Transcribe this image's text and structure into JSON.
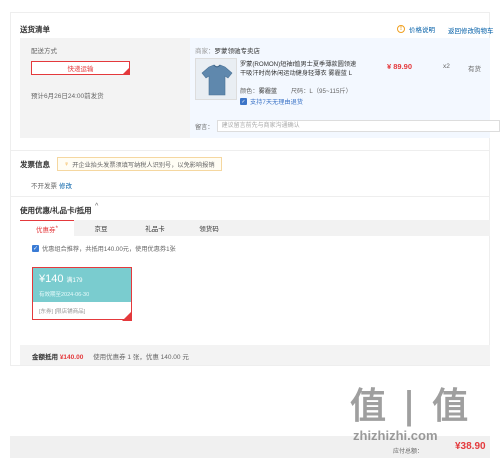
{
  "section_list": {
    "title": "送货清单",
    "price_explain": "价格说明",
    "return_edit": "返回修改购物车"
  },
  "shipping": {
    "label": "配送方式",
    "method": "快递运输",
    "date": "预计6月26日24:00前发货"
  },
  "store": {
    "label": "商家：",
    "name": "罗蒙领驰专卖店"
  },
  "goods": {
    "title": "罗蒙(ROMON)短袖t恤男士夏季薄款圆领速干吸汗时尚休闲运动健身轻薄衣 雾霾蓝 L",
    "price": "¥ 89.90",
    "qty": "x2",
    "stock": "有货",
    "color_label": "颜色：",
    "color": "雾霾蓝",
    "size_label": "尺码：",
    "size": "L（95~115斤）",
    "return_note": "支持7天无理由退货",
    "return_icon": "check-shield-icon"
  },
  "remark": {
    "label": "留言：",
    "placeholder": "建议留言前先与商家沟通确认"
  },
  "invoice": {
    "title": "发票信息",
    "tip": "开企业抬头发票须填写纳税人识别号，以免影响报销",
    "status": "不开发票",
    "edit": "修改"
  },
  "coupons": {
    "title": "使用优惠/礼品卡/抵用",
    "caret": "^",
    "tabs": [
      {
        "label": "优惠券",
        "active": true,
        "badge": "*"
      },
      {
        "label": "京豆",
        "active": false
      },
      {
        "label": "礼品卡",
        "active": false
      },
      {
        "label": "领货码",
        "active": false
      }
    ],
    "combo_text": "优惠组合推荐，共抵用140.00元，使用优惠券1张",
    "coupon": {
      "amount": "¥140",
      "condition": "满179",
      "expiry": "有效期至2024-06-30",
      "tags": "[东券] [限店铺商品]"
    },
    "summary_label": "金额抵用",
    "summary_amount": "¥140.00",
    "summary_detail": "使用优惠券 1 张，优惠 140.00 元"
  },
  "totals": {
    "pay_label": "应付总额：",
    "pay_amount": "¥38.90"
  },
  "watermark": {
    "glyphs": "值 | 值",
    "url": "zhizhizhi.com"
  },
  "colors": {
    "accent": "#e4393c",
    "link": "#005ea7",
    "coupon_bg": "#7acccf"
  }
}
